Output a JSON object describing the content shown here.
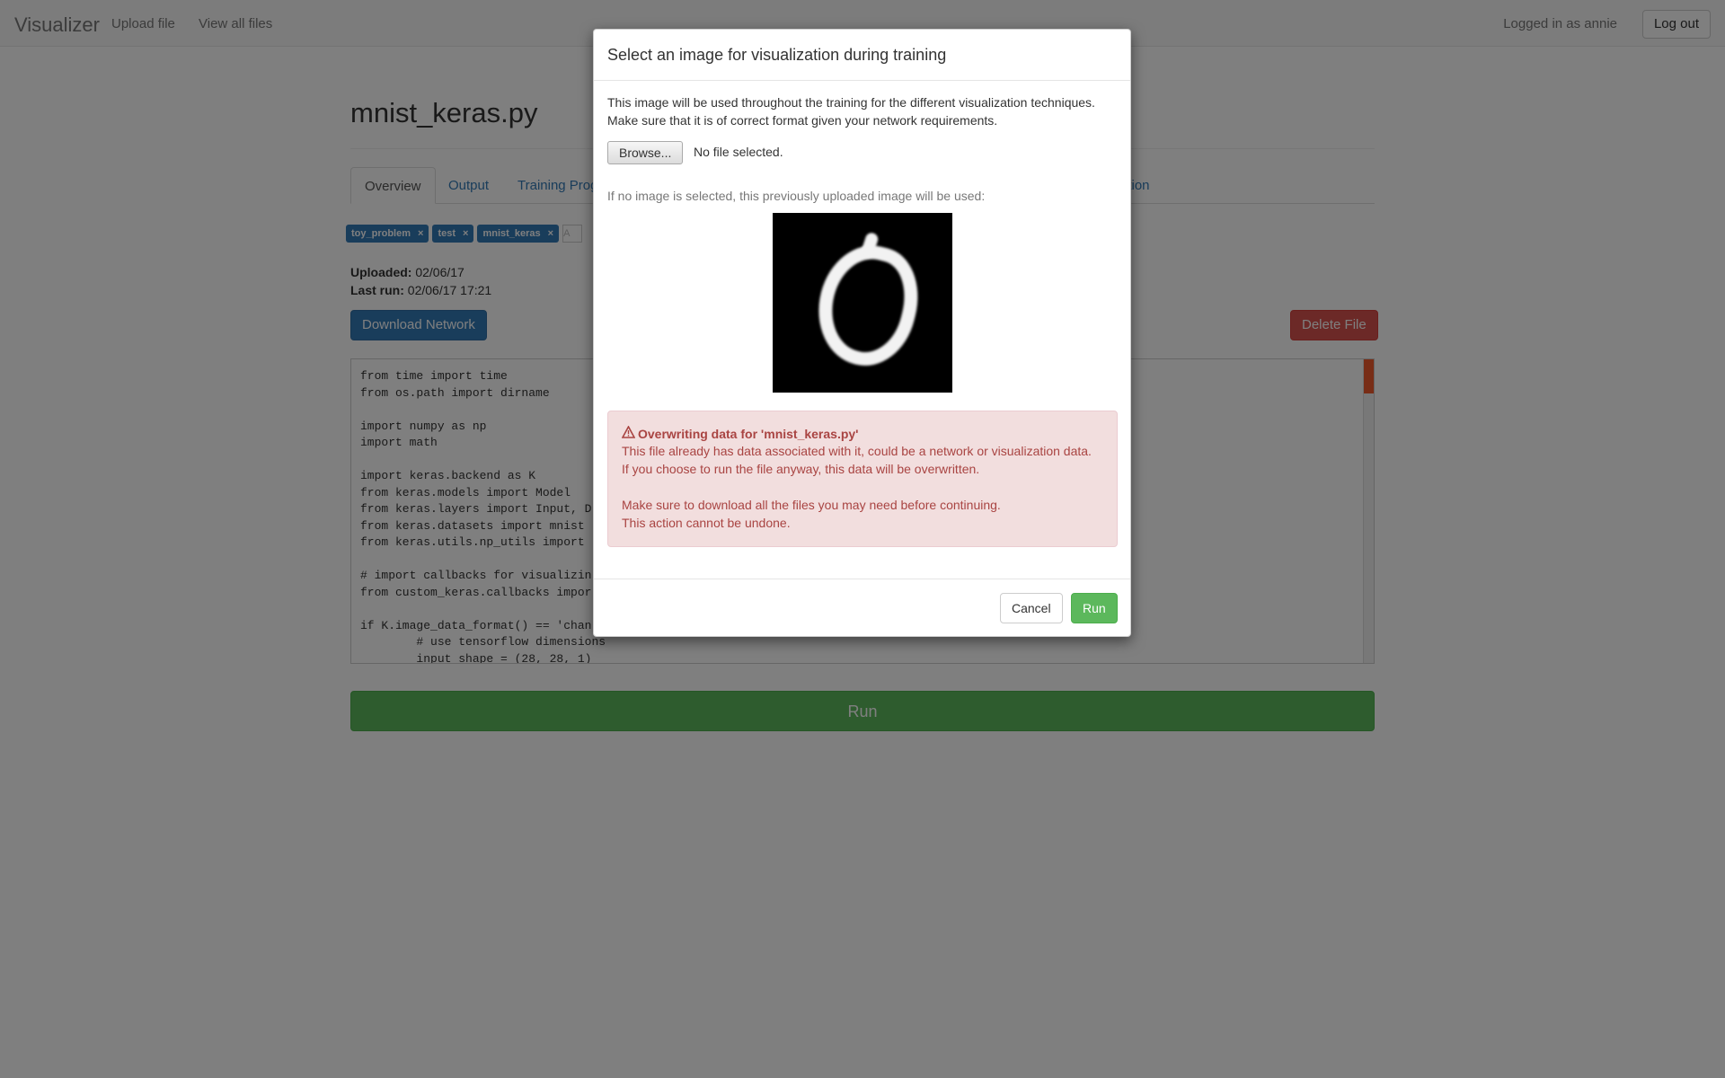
{
  "navbar": {
    "brand": "Visualizer",
    "links": [
      "Upload file",
      "View all files"
    ],
    "user_text": "Logged in as annie",
    "logout_label": "Log out"
  },
  "file": {
    "title": "mnist_keras.py",
    "tabs": [
      "Overview",
      "Output",
      "Training Prog",
      "ation"
    ],
    "tags": [
      "toy_problem",
      "test",
      "mnist_keras"
    ],
    "tag_input_placeholder": "A",
    "uploaded_label": "Uploaded:",
    "uploaded_value": "02/06/17",
    "last_run_label": "Last run:",
    "last_run_value": "02/06/17 17:21",
    "download_label": "Download Network",
    "delete_label": "Delete File",
    "code_lines": [
      "from time import time",
      "from os.path import dirname",
      "",
      "import numpy as np",
      "import math",
      "",
      "import keras.backend as K",
      "from keras.models import Model",
      "from keras.layers import Input, D",
      "from keras.datasets import mnist",
      "from keras.utils.np_utils import",
      "",
      "# import callbacks for visualizin",
      "from custom_keras.callbacks impor",
      "",
      "if K.image_data_format() == 'chan",
      "        # use tensorflow dimensions",
      "        input_shape = (28, 28, 1)"
    ],
    "run_label": "Run"
  },
  "modal": {
    "title": "Select an image for visualization during training",
    "description_line1": "This image will be used throughout the training for the different visualization techniques.",
    "description_line2": "Make sure that it is of correct format given your network requirements.",
    "browse_label": "Browse...",
    "file_status": "No file selected.",
    "fallback_hint": "If no image is selected, this previously uploaded image will be used:",
    "alert": {
      "icon": "warning-triangle-icon",
      "title": "Overwriting data for 'mnist_keras.py'",
      "line1": "This file already has data associated with it, could be a network or visualization data.",
      "line2": "If you choose to run the file anyway, this data will be overwritten.",
      "line3": "Make sure to download all the files you may need before continuing.",
      "line4": "This action cannot be undone."
    },
    "cancel_label": "Cancel",
    "run_label": "Run"
  }
}
